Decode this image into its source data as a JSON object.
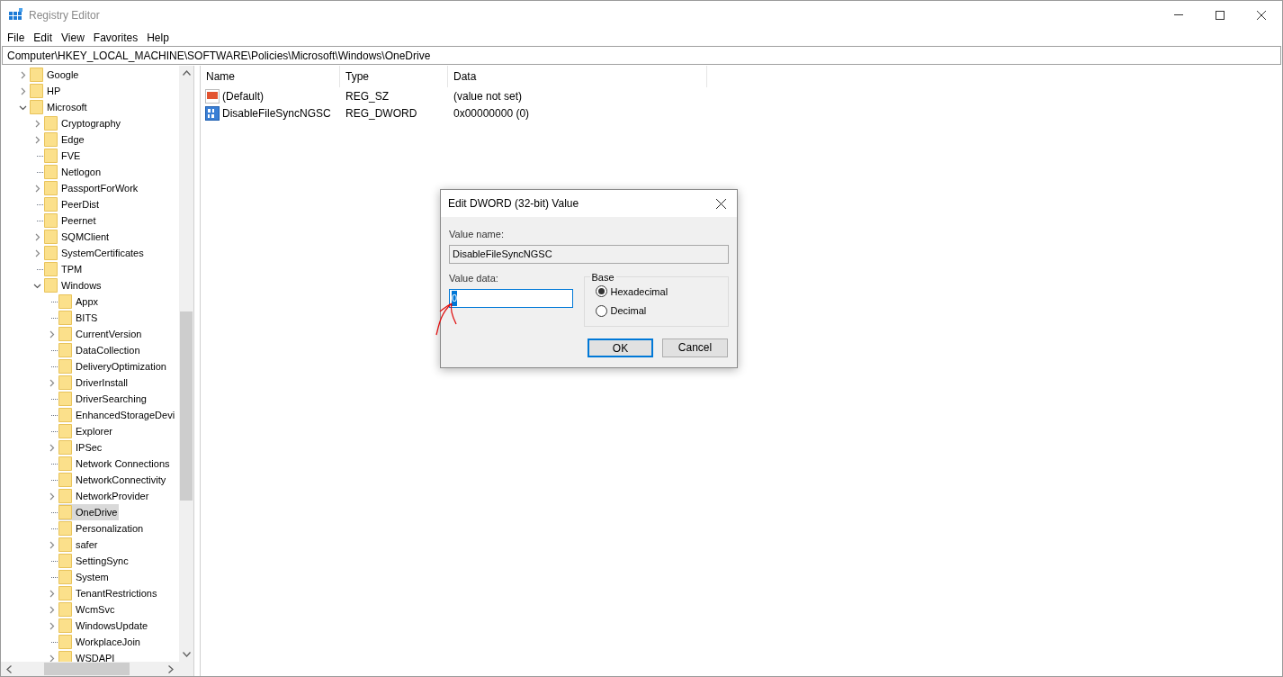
{
  "window": {
    "title": "Registry Editor"
  },
  "menu": [
    "File",
    "Edit",
    "View",
    "Favorites",
    "Help"
  ],
  "address": "Computer\\HKEY_LOCAL_MACHINE\\SOFTWARE\\Policies\\Microsoft\\Windows\\OneDrive",
  "tree": [
    {
      "label": "Google",
      "expandable": true,
      "expanded": false,
      "selected": false
    },
    {
      "label": "HP",
      "expandable": true,
      "expanded": false,
      "selected": false
    },
    {
      "label": "Microsoft",
      "expandable": true,
      "expanded": true,
      "selected": false,
      "children": [
        {
          "label": "Cryptography",
          "expandable": true,
          "expanded": false,
          "selected": false
        },
        {
          "label": "Edge",
          "expandable": true,
          "expanded": false,
          "selected": false
        },
        {
          "label": "FVE",
          "expandable": false,
          "expanded": false,
          "selected": false
        },
        {
          "label": "Netlogon",
          "expandable": false,
          "expanded": false,
          "selected": false
        },
        {
          "label": "PassportForWork",
          "expandable": true,
          "expanded": false,
          "selected": false
        },
        {
          "label": "PeerDist",
          "expandable": false,
          "expanded": false,
          "selected": false
        },
        {
          "label": "Peernet",
          "expandable": false,
          "expanded": false,
          "selected": false
        },
        {
          "label": "SQMClient",
          "expandable": true,
          "expanded": false,
          "selected": false
        },
        {
          "label": "SystemCertificates",
          "expandable": true,
          "expanded": false,
          "selected": false
        },
        {
          "label": "TPM",
          "expandable": false,
          "expanded": false,
          "selected": false
        },
        {
          "label": "Windows",
          "expandable": true,
          "expanded": true,
          "selected": false,
          "children": [
            {
              "label": "Appx",
              "expandable": false,
              "expanded": false,
              "selected": false
            },
            {
              "label": "BITS",
              "expandable": false,
              "expanded": false,
              "selected": false
            },
            {
              "label": "CurrentVersion",
              "expandable": true,
              "expanded": false,
              "selected": false
            },
            {
              "label": "DataCollection",
              "expandable": false,
              "expanded": false,
              "selected": false
            },
            {
              "label": "DeliveryOptimization",
              "expandable": false,
              "expanded": false,
              "selected": false
            },
            {
              "label": "DriverInstall",
              "expandable": true,
              "expanded": false,
              "selected": false
            },
            {
              "label": "DriverSearching",
              "expandable": false,
              "expanded": false,
              "selected": false
            },
            {
              "label": "EnhancedStorageDevi",
              "expandable": false,
              "expanded": false,
              "selected": false
            },
            {
              "label": "Explorer",
              "expandable": false,
              "expanded": false,
              "selected": false
            },
            {
              "label": "IPSec",
              "expandable": true,
              "expanded": false,
              "selected": false
            },
            {
              "label": "Network Connections",
              "expandable": false,
              "expanded": false,
              "selected": false
            },
            {
              "label": "NetworkConnectivity",
              "expandable": false,
              "expanded": false,
              "selected": false
            },
            {
              "label": "NetworkProvider",
              "expandable": true,
              "expanded": false,
              "selected": false
            },
            {
              "label": "OneDrive",
              "expandable": false,
              "expanded": false,
              "selected": true
            },
            {
              "label": "Personalization",
              "expandable": false,
              "expanded": false,
              "selected": false
            },
            {
              "label": "safer",
              "expandable": true,
              "expanded": false,
              "selected": false
            },
            {
              "label": "SettingSync",
              "expandable": false,
              "expanded": false,
              "selected": false
            },
            {
              "label": "System",
              "expandable": false,
              "expanded": false,
              "selected": false
            },
            {
              "label": "TenantRestrictions",
              "expandable": true,
              "expanded": false,
              "selected": false
            },
            {
              "label": "WcmSvc",
              "expandable": true,
              "expanded": false,
              "selected": false
            },
            {
              "label": "WindowsUpdate",
              "expandable": true,
              "expanded": false,
              "selected": false
            },
            {
              "label": "WorkplaceJoin",
              "expandable": false,
              "expanded": false,
              "selected": false
            },
            {
              "label": "WSDAPI",
              "expandable": true,
              "expanded": false,
              "selected": false
            }
          ]
        }
      ]
    }
  ],
  "values": {
    "columns": [
      "Name",
      "Type",
      "Data"
    ],
    "rows": [
      {
        "kind": "string",
        "name": "(Default)",
        "type": "REG_SZ",
        "data": "(value not set)"
      },
      {
        "kind": "binary",
        "name": "DisableFileSyncNGSC",
        "type": "REG_DWORD",
        "data": "0x00000000 (0)"
      }
    ]
  },
  "dialog": {
    "title": "Edit DWORD (32-bit) Value",
    "value_name_label": "Value name:",
    "value_name": "DisableFileSyncNGSC",
    "value_data_label": "Value data:",
    "value_data": "0",
    "value_data_highlighted": true,
    "base": {
      "label": "Base",
      "options": [
        {
          "label": "Hexadecimal",
          "selected": true
        },
        {
          "label": "Decimal",
          "selected": false
        }
      ]
    },
    "buttons": [
      {
        "label": "OK",
        "default": true
      },
      {
        "label": "Cancel",
        "default": false
      }
    ]
  }
}
